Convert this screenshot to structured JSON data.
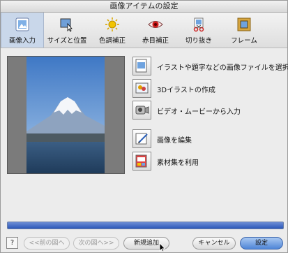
{
  "window": {
    "title": "画像アイテムの設定"
  },
  "toolbar": {
    "items": [
      {
        "label": "画像入力",
        "icon": "image-input-icon",
        "active": true
      },
      {
        "label": "サイズと位置",
        "icon": "size-position-icon",
        "active": false
      },
      {
        "label": "色調補正",
        "icon": "color-correction-icon",
        "active": false
      },
      {
        "label": "赤目補正",
        "icon": "red-eye-icon",
        "active": false
      },
      {
        "label": "切り抜き",
        "icon": "crop-icon",
        "active": false
      },
      {
        "label": "フレーム",
        "icon": "frame-icon",
        "active": false
      }
    ]
  },
  "actions": [
    {
      "label": "イラストや題字などの画像ファイルを選択",
      "icon": "image-file-icon"
    },
    {
      "label": "3Dイラストの作成",
      "icon": "3d-illustration-icon"
    },
    {
      "label": "ビデオ・ムービーから入力",
      "icon": "video-camera-icon"
    },
    {
      "label": "画像を編集",
      "icon": "edit-image-icon"
    },
    {
      "label": "素材集を利用",
      "icon": "clipart-collection-icon"
    }
  ],
  "footer": {
    "help": "?",
    "prev": "<<前の図へ",
    "next": "次の図へ>>",
    "add_new": "新規追加",
    "cancel": "キャンセル",
    "ok": "設定"
  }
}
